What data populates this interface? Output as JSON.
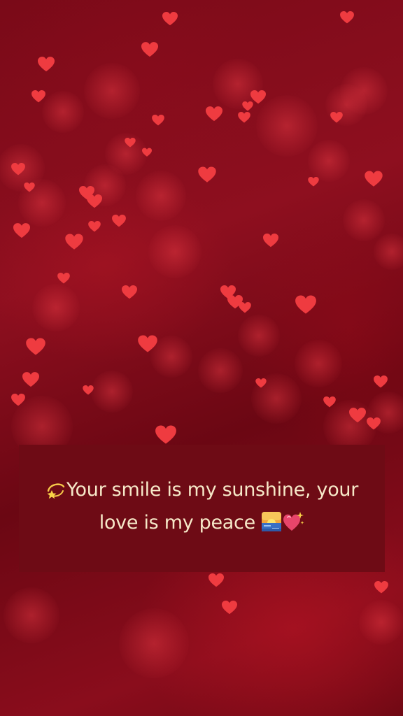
{
  "quote": {
    "lead_icon": "dizzy-star-icon",
    "line1": "Your smile is my sunshine, your",
    "line2": "love is my peace",
    "trail_icons": [
      "sunrise-icon",
      "sparkling-heart-icon"
    ]
  },
  "colors": {
    "background": "#7a0a18",
    "heart": "#ef3b40",
    "box": "#6e0b15",
    "text": "#f6e8c8"
  }
}
